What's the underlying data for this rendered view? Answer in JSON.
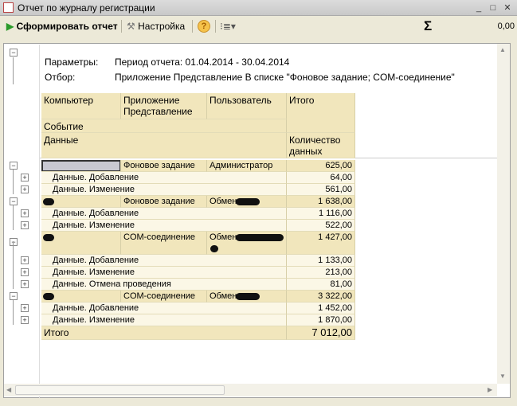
{
  "window": {
    "title": "Отчет по журналу регистрации",
    "minimize": "_",
    "maximize": "□",
    "close": "✕"
  },
  "toolbar": {
    "generate": "Сформировать отчет",
    "settings": "Настройка",
    "help": "?",
    "sum_symbol": "Σ",
    "sum_value": "0,00"
  },
  "params": {
    "period_label": "Параметры:",
    "period_value": "Период отчета: 01.04.2014 - 30.04.2014",
    "filter_label": "Отбор:",
    "filter_value": "Приложение Представление В списке \"Фоновое задание; COM-соединение\""
  },
  "headers": {
    "computer": "Компьютер",
    "app": "Приложение Представление",
    "user": "Пользователь",
    "total": "Итого",
    "event": "Событие",
    "data": "Данные",
    "count": "Количество данных"
  },
  "rows": [
    {
      "type": "group",
      "app": "Фоновое задание",
      "user": "Администратор",
      "value": "625,00"
    },
    {
      "type": "detail",
      "label": "Данные. Добавление",
      "value": "64,00"
    },
    {
      "type": "detail",
      "label": "Данные. Изменение",
      "value": "561,00"
    },
    {
      "type": "group",
      "app": "Фоновое задание",
      "user": "Обмен",
      "value": "1 638,00"
    },
    {
      "type": "detail",
      "label": "Данные. Добавление",
      "value": "1 116,00"
    },
    {
      "type": "detail",
      "label": "Данные. Изменение",
      "value": "522,00"
    },
    {
      "type": "group",
      "app": "COM-соединение",
      "user": "Обмен",
      "value": "1 427,00"
    },
    {
      "type": "detail",
      "label": "Данные. Добавление",
      "value": "1 133,00"
    },
    {
      "type": "detail",
      "label": "Данные. Изменение",
      "value": "213,00"
    },
    {
      "type": "detail",
      "label": "Данные. Отмена проведения",
      "value": "81,00"
    },
    {
      "type": "group",
      "app": "COM-соединение",
      "user": "Обмен",
      "value": "3 322,00"
    },
    {
      "type": "detail",
      "label": "Данные. Добавление",
      "value": "1 452,00"
    },
    {
      "type": "detail",
      "label": "Данные. Изменение",
      "value": "1 870,00"
    }
  ],
  "total": {
    "label": "Итого",
    "value": "7 012,00"
  },
  "colors": {
    "header": "#f1e6bc",
    "detail": "#fbf7e6"
  }
}
